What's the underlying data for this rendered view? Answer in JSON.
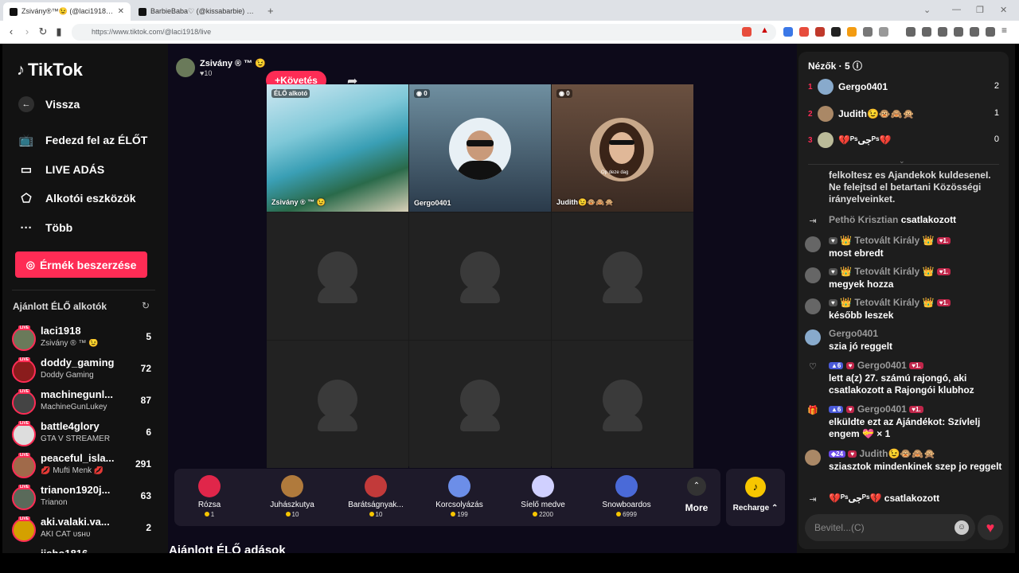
{
  "browser": {
    "tabs": [
      {
        "label": "Zsivány®™😉 (@laci1918) É…",
        "active": true
      },
      {
        "label": "BarbieBaba♡ (@kissabarbie) ÉLŐ ad…",
        "active": false
      }
    ],
    "url": "https://www.tiktok.com/@laci1918/live"
  },
  "sidebar": {
    "logo": "TikTok",
    "back": "Vissza",
    "nav": [
      "Fedezd fel az ÉLŐT",
      "LIVE ADÁS",
      "Alkotói eszközök",
      "Több"
    ],
    "coins_button": "Érmék beszerzése",
    "recommended_title": "Ajánlott ÉLŐ alkotók",
    "live_label": "LIVE",
    "creators": [
      {
        "name": "laci1918",
        "sub": "Zsivány ® ™ 😉",
        "count": "5"
      },
      {
        "name": "doddy_gaming",
        "sub": "Doddy Gaming",
        "count": "72"
      },
      {
        "name": "machinegunl...",
        "sub": "MachineGunLukey",
        "count": "87"
      },
      {
        "name": "battle4glory",
        "sub": "GTA V STREAMER",
        "count": "6"
      },
      {
        "name": "peaceful_isla...",
        "sub": "💋 Mufti Menk 💋",
        "count": "291"
      },
      {
        "name": "trianon1920j...",
        "sub": "Trianon",
        "count": "63"
      },
      {
        "name": "aki.valaki.va...",
        "sub": "AKI CAT ᴜꜱʜᴜ",
        "count": "2"
      },
      {
        "name": "jisho1816",
        "sub": "",
        "count": ""
      }
    ]
  },
  "stream": {
    "host": "Zsivány ® ™ 😉",
    "likes": "♥10",
    "follow": "+Követés",
    "guests": [
      {
        "badge": "ÉLŐ alkotó",
        "name": "Zsivány ® ™ 😉"
      },
      {
        "badge": "◉ 0",
        "name": "Gergo0401"
      },
      {
        "badge": "◉ 0",
        "name": "Judith😉🐵🙈🙊",
        "tag": "Op deze dag"
      }
    ]
  },
  "gifts": [
    {
      "name": "Rózsa",
      "price": "1",
      "color": "#e0264a"
    },
    {
      "name": "Juhászkutya",
      "price": "10",
      "color": "#b07a3c"
    },
    {
      "name": "Barátságnyak...",
      "price": "10",
      "color": "#c23a3a"
    },
    {
      "name": "Korcsolyázás",
      "price": "199",
      "color": "#6c8ee8"
    },
    {
      "name": "Síelő medve",
      "price": "2200",
      "color": "#d0d0ff"
    },
    {
      "name": "Snowboardos",
      "price": "6999",
      "color": "#4a6ad8"
    }
  ],
  "gift_more": "More",
  "recharge": "Recharge ⌃",
  "recommended_live": "Ajánlott ÉLŐ adások",
  "chat": {
    "viewers_title": "Nézők · 5 ⓘ",
    "viewers": [
      {
        "rank": "1",
        "name": "Gergo0401",
        "score": "2"
      },
      {
        "rank": "2",
        "name": "Judith😉🐵🙈🙊",
        "score": "1"
      },
      {
        "rank": "3",
        "name": "💔ᴾˢجیᴾˢ💔",
        "score": "0"
      }
    ],
    "messages": [
      {
        "type": "text",
        "body": "felkoltesz es Ajandekok kuldeseneI. Ne felejtsd el betartani Közösségi irányelveinket."
      },
      {
        "type": "join",
        "user": "Pethö Krisztian",
        "text": "csatlakozott"
      },
      {
        "type": "chat",
        "user": "👑 Tetovált Király 👑",
        "body": "most ebredt"
      },
      {
        "type": "chat",
        "user": "👑 Tetovált Király 👑",
        "body": "megyek hozza"
      },
      {
        "type": "chat",
        "user": "👑 Tetovált Király 👑",
        "body": "később leszek"
      },
      {
        "type": "chat",
        "user": "Gergo0401",
        "body": "szia jó reggelt"
      },
      {
        "type": "fan",
        "user": "Gergo0401",
        "level": "6",
        "body": "lett a(z) 27. számú rajongó, aki csatlakozott a Rajongói klubhoz"
      },
      {
        "type": "gift",
        "user": "Gergo0401",
        "level": "6",
        "body": "elküldte ezt az Ajándékot: Szívlelj engem 💝 × 1"
      },
      {
        "type": "chat2",
        "user": "Judith😉🐵🙈🙊",
        "level": "24",
        "body": "sziasztok mindenkinek szep jo reggelt"
      },
      {
        "type": "join",
        "user": "💔ᴾˢجیᴾˢ💔",
        "text": "csatlakozott"
      }
    ],
    "input_placeholder": "Bevitel...(C)"
  },
  "colors": {
    "accent": "#fe2c55",
    "coin": "#f7c600"
  }
}
